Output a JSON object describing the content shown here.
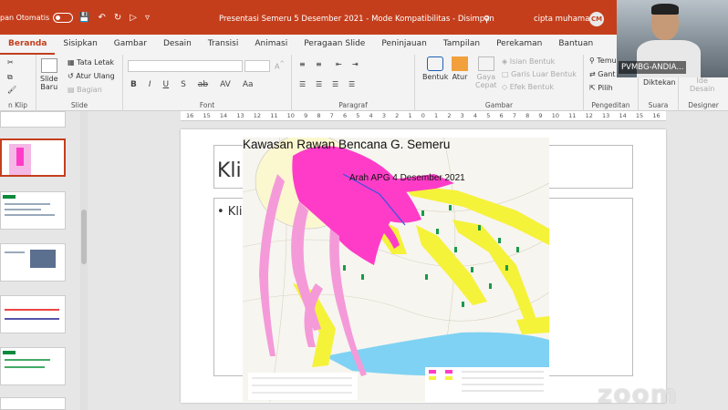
{
  "titlebar": {
    "autosave_label": "pan Otomatis",
    "doc_title": "Presentasi Semeru 5 Desember 2021",
    "mode": "Mode Kompatibilitas",
    "save_state": "Disimpan",
    "user_name": "cipta muhamad",
    "avatar_initials": "CM",
    "search_icon": "search-icon"
  },
  "tabs": [
    "Beranda",
    "Sisipkan",
    "Gambar",
    "Desain",
    "Transisi",
    "Animasi",
    "Peragaan Slide",
    "Peninjauan",
    "Tampilan",
    "Perekaman",
    "Bantuan"
  ],
  "ribbon": {
    "clipboard_label": "n Klip",
    "slide": {
      "new_slide": "Slide",
      "new_slide2": "Baru",
      "layout": "Tata Letak",
      "reset": "Atur Ulang",
      "section": "Bagian",
      "group_label": "Slide"
    },
    "font": {
      "increase": "A^",
      "decrease": "Aˇ",
      "buttons": [
        "B",
        "I",
        "U",
        "S",
        "ab",
        "AV",
        "Aa"
      ],
      "group_label": "Font"
    },
    "paragraph": {
      "group_label": "Paragraf"
    },
    "drawing": {
      "shapes": "Bentuk",
      "arrange": "Atur",
      "quick_styles": "Gaya",
      "quick_styles2": "Cepat",
      "fill": "Isian Bentuk",
      "outline": "Garis Luar Bentuk",
      "effects": "Efek Bentuk",
      "group_label": "Gambar"
    },
    "editing": {
      "find": "Temu",
      "replace": "Gant",
      "select": "Pilih",
      "group_label": "Pengeditan"
    },
    "voice": {
      "dictate": "Diktekan",
      "group_label": "Suara"
    },
    "designer": {
      "ideas": "Ide",
      "ideas2": "Desain",
      "group_label": "Designer"
    }
  },
  "video": {
    "name": "PVMBG-ANDIA..."
  },
  "ruler": {
    "ticks": [
      "16",
      "15",
      "14",
      "13",
      "12",
      "11",
      "10",
      "9",
      "8",
      "7",
      "6",
      "5",
      "4",
      "3",
      "2",
      "1",
      "0",
      "1",
      "2",
      "3",
      "4",
      "5",
      "6",
      "7",
      "8",
      "9",
      "10",
      "11",
      "12",
      "13",
      "14",
      "15",
      "16"
    ]
  },
  "slide": {
    "title_partial": "Kli",
    "bullet_partial": "• Kli"
  },
  "map": {
    "title": "Kawasan Rawan Bencana G. Semeru",
    "annotation": "Arah APG 4 Desember 2021"
  },
  "watermark": "zoom",
  "colors": {
    "accent": "#c43e1c",
    "hazard_pink": "#ff3cc8",
    "hazard_yellow": "#f5f23a"
  }
}
